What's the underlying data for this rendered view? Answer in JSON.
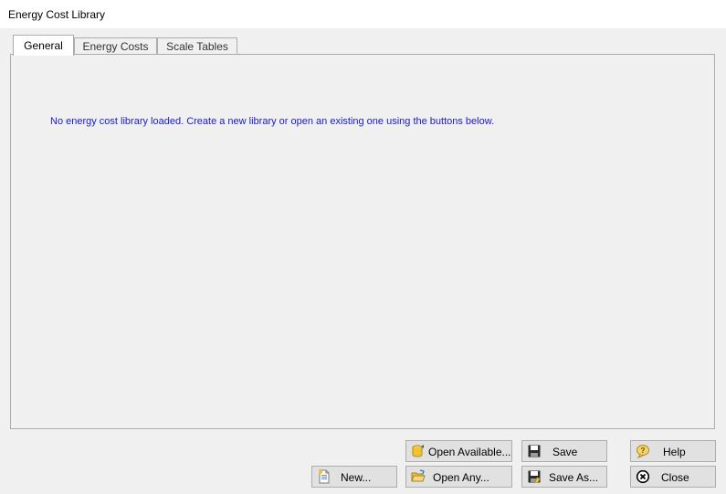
{
  "window": {
    "title": "Energy Cost Library"
  },
  "tabs": [
    {
      "label": "General",
      "active": true
    },
    {
      "label": "Energy Costs",
      "active": false
    },
    {
      "label": "Scale Tables",
      "active": false
    }
  ],
  "general": {
    "message": "No energy cost library loaded. Create a new library or open an existing one using the buttons below."
  },
  "buttons": {
    "new": "New...",
    "open_available": "Open Available...",
    "open_any": "Open Any...",
    "save": "Save",
    "save_as": "Save As...",
    "help": "Help",
    "close": "Close"
  },
  "icons": {
    "new": "new-document-icon",
    "open_available": "database-open-icon",
    "open_any": "folder-open-icon",
    "save": "floppy-disk-icon",
    "save_as": "floppy-disk-save-as-icon",
    "help": "question-bubble-icon",
    "close": "close-circle-icon"
  },
  "colors": {
    "message_text": "#1a1ac8",
    "button_face": "#e1e1e1",
    "dialog_bg": "#f0f0f0"
  }
}
